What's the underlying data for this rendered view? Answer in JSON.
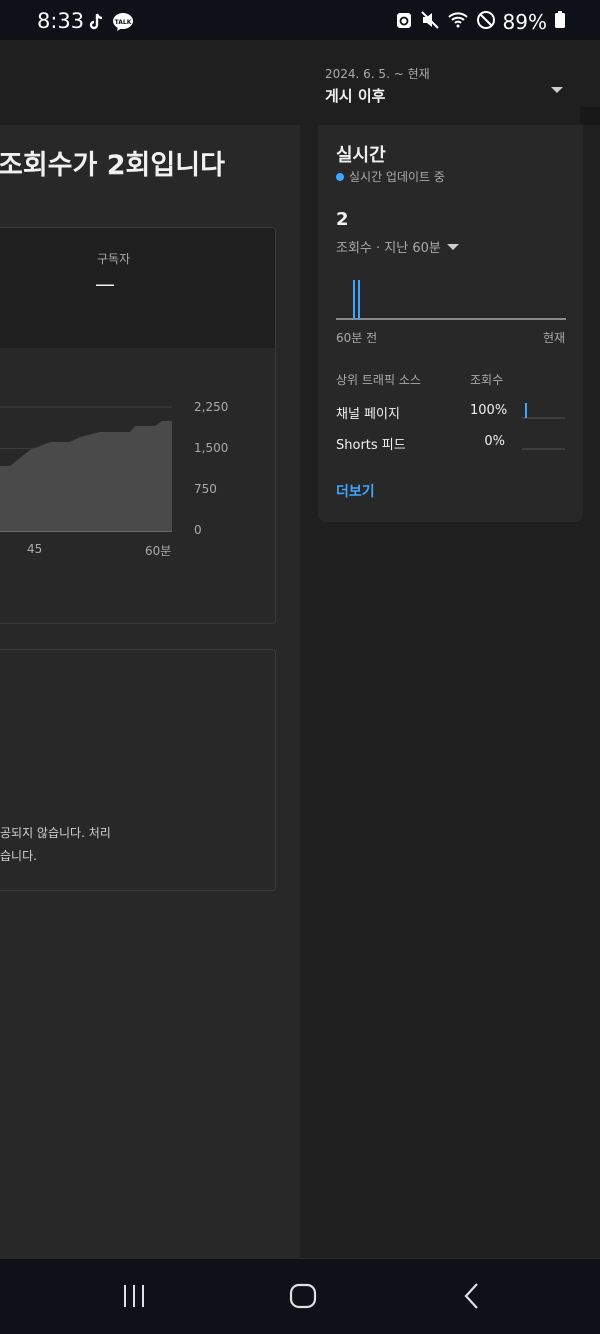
{
  "status_bar": {
    "time": "8:33",
    "battery": "89%",
    "left_icons": [
      "tiktok-icon",
      "kakaotalk-icon"
    ],
    "right_icons": [
      "sync-icon",
      "mute-icon",
      "wifi-icon",
      "do-not-disturb-icon",
      "battery-icon"
    ]
  },
  "header": {
    "date_range": "2024. 6. 5. ~ 현재",
    "period": "게시 이후"
  },
  "main": {
    "headline": "조회수가 2회입니다",
    "subscribers_label": "구독자",
    "subscribers_value": "—",
    "note_line1": "공되지 않습니다. 처리",
    "note_line2": "습니다."
  },
  "chart_data": {
    "type": "area",
    "x_ticks": [
      "45",
      "60분"
    ],
    "y_ticks": [
      "2,250",
      "1,500",
      "750",
      "0"
    ],
    "ylim": [
      0,
      2250
    ],
    "grid": true
  },
  "realtime": {
    "title": "실시간",
    "live_label": "실시간 업데이트 중",
    "count": "2",
    "metric_label": "조회수 · 지난 60분",
    "axis_left": "60분 전",
    "axis_right": "현재",
    "traffic_header": "상위 트래픽 소스",
    "views_header": "조회수",
    "sources": [
      {
        "name": "채널 페이지",
        "percent": "100%",
        "share": 1.0
      },
      {
        "name": "Shorts 피드",
        "percent": "0%",
        "share": 0.0
      }
    ],
    "more_label": "더보기",
    "accent_color": "#3ea6ff"
  },
  "nav": {
    "icons": [
      "recent-apps-icon",
      "home-icon",
      "back-icon"
    ]
  }
}
